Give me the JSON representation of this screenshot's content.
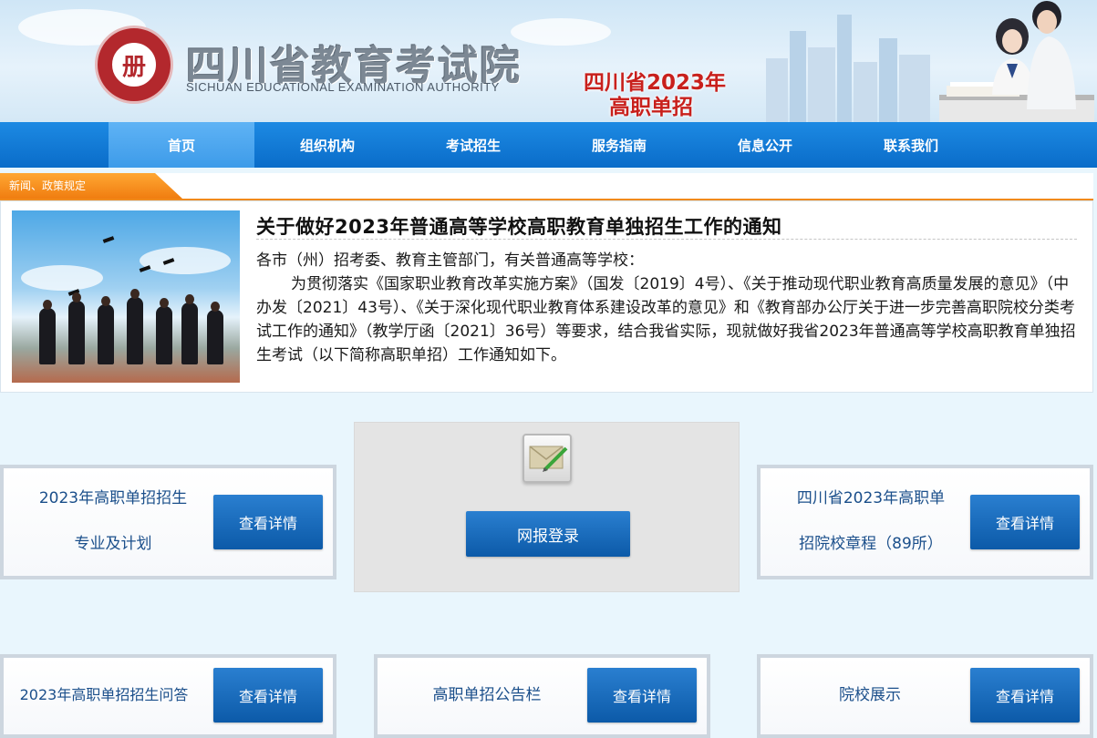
{
  "header": {
    "org_name": "四川省教育考试院",
    "org_name_en": "SICHUAN EDUCATIONAL EXAMINATION AUTHORITY",
    "banner_line1": "四川省2023年",
    "banner_line2": "高职单招",
    "emblem_icon": "seal-emblem-icon"
  },
  "nav": {
    "items": [
      {
        "label": "首页"
      },
      {
        "label": "组织机构"
      },
      {
        "label": "考试招生"
      },
      {
        "label": "服务指南"
      },
      {
        "label": "信息公开"
      },
      {
        "label": "联系我们"
      }
    ],
    "active_color": "#3d9be9",
    "bar_color": "#0a6cc9"
  },
  "news": {
    "tab_label": "新闻、政策规定",
    "title": "关于做好2023年普通高等学校高职教育单独招生工作的通知",
    "salutation": "各市（州）招考委、教育主管部门，有关普通高等学校：",
    "paragraph": "为贯彻落实《国家职业教育改革实施方案》（国发〔2019〕4号）、《关于推动现代职业教育高质量发展的意见》（中办发〔2021〕43号）、《关于深化现代职业教育体系建设改革的意见》和《教育部办公厅关于进一步完善高职院校分类考试工作的通知》（教学厅函〔2021〕36号）等要求，结合我省实际，现就做好我省2023年普通高等学校高职教育单独招生考试（以下简称高职单招）工作通知如下。"
  },
  "cards": {
    "detail_label": "查看详情",
    "major_plan": {
      "line1": "2023年高职单招招生",
      "line2": "专业及计划"
    },
    "school_charter": {
      "line1": "四川省2023年高职单",
      "line2": "招院校章程（89所）"
    },
    "qa": {
      "label": "2023年高职单招招生问答"
    },
    "notice_board": {
      "label": "高职单招公告栏"
    },
    "school_show": {
      "label": "院校展示"
    }
  },
  "login": {
    "label": "网报登录",
    "icon": "mail-edit-icon"
  },
  "colors": {
    "accent_orange": "#f08a1c",
    "button_blue": "#0c5aa8",
    "card_text": "#1b4f8b"
  }
}
